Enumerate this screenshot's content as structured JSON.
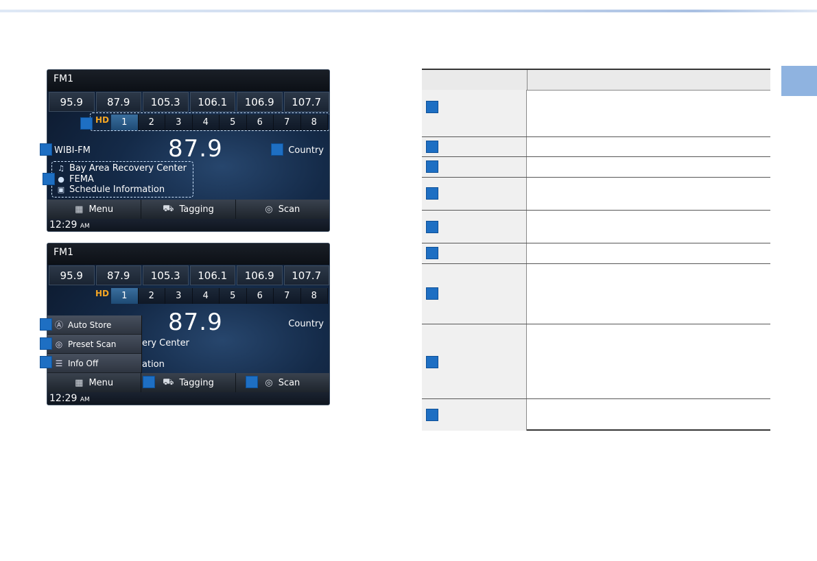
{
  "screen1": {
    "band": "FM1",
    "presets": [
      "95.9",
      "87.9",
      "105.3",
      "106.1",
      "106.9",
      "107.7"
    ],
    "hd_label": "HD",
    "hd_channels": [
      "1",
      "2",
      "3",
      "4",
      "5",
      "6",
      "7",
      "8"
    ],
    "station_id": "WIBI-FM",
    "frequency": "87.9",
    "genre": "Country",
    "info": {
      "song": "Bay Area Recovery Center",
      "artist": "FEMA",
      "program": "Schedule Information"
    },
    "bottom": {
      "menu": "Menu",
      "tagging": "Tagging",
      "scan": "Scan"
    },
    "clock": "12:29",
    "ampm": "AM"
  },
  "screen2": {
    "band": "FM1",
    "presets": [
      "95.9",
      "87.9",
      "105.3",
      "106.1",
      "106.9",
      "107.7"
    ],
    "hd_label": "HD",
    "hd_channels": [
      "1",
      "2",
      "3",
      "4",
      "5",
      "6",
      "7",
      "8"
    ],
    "frequency": "87.9",
    "genre": "Country",
    "partial_info_1": "ery Center",
    "partial_info_2": "ation",
    "popup": {
      "auto_store": "Auto Store",
      "preset_scan": "Preset Scan",
      "info_off": "Info Off"
    },
    "bottom": {
      "menu": "Menu",
      "tagging": "Tagging",
      "scan": "Scan"
    },
    "clock": "12:29",
    "ampm": "AM"
  },
  "icons": {
    "note": "music-note-icon",
    "person": "person-icon",
    "schedule": "schedule-icon",
    "menu": "menu-grid-icon",
    "tagging": "cart-tag-icon",
    "scan": "scan-icon",
    "auto_store": "auto-store-icon",
    "preset_scan": "preset-scan-icon",
    "info_off": "info-off-icon"
  },
  "colors": {
    "callout": "#1e6fc3",
    "hd_orange": "#f5a623",
    "side_tab": "#8fb3e0"
  }
}
